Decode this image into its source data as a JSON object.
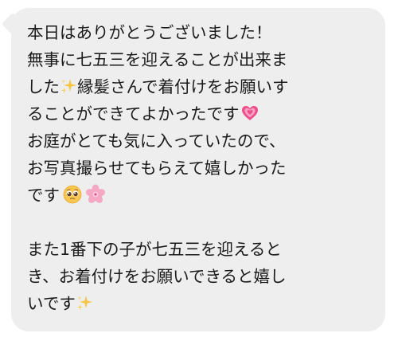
{
  "message": {
    "lines": [
      "本日はありがとうございました！",
      "無事に七五三を迎えることが出来ま",
      "した",
      "縁髪さんで着付けをお願いす",
      "ることができてよかったです",
      "お庭がとても気に入っていたので、",
      "お写真撮らせてもらえて嬉しかった",
      "です",
      "また1番下の子が七五三を迎えると",
      "き、お着付けをお願いできると嬉し",
      "いです"
    ]
  },
  "icons": {
    "sparkles": "sparkles-icon",
    "heart": "growing-heart-icon",
    "pleading": "pleading-face-icon",
    "blossom": "cherry-blossom-icon"
  },
  "colors": {
    "bubble": "#eeeeee",
    "text": "#1a1a1a",
    "heart": "#ee4f8c",
    "sparkles": "#f5c542",
    "blossom": "#f4a8c4"
  }
}
